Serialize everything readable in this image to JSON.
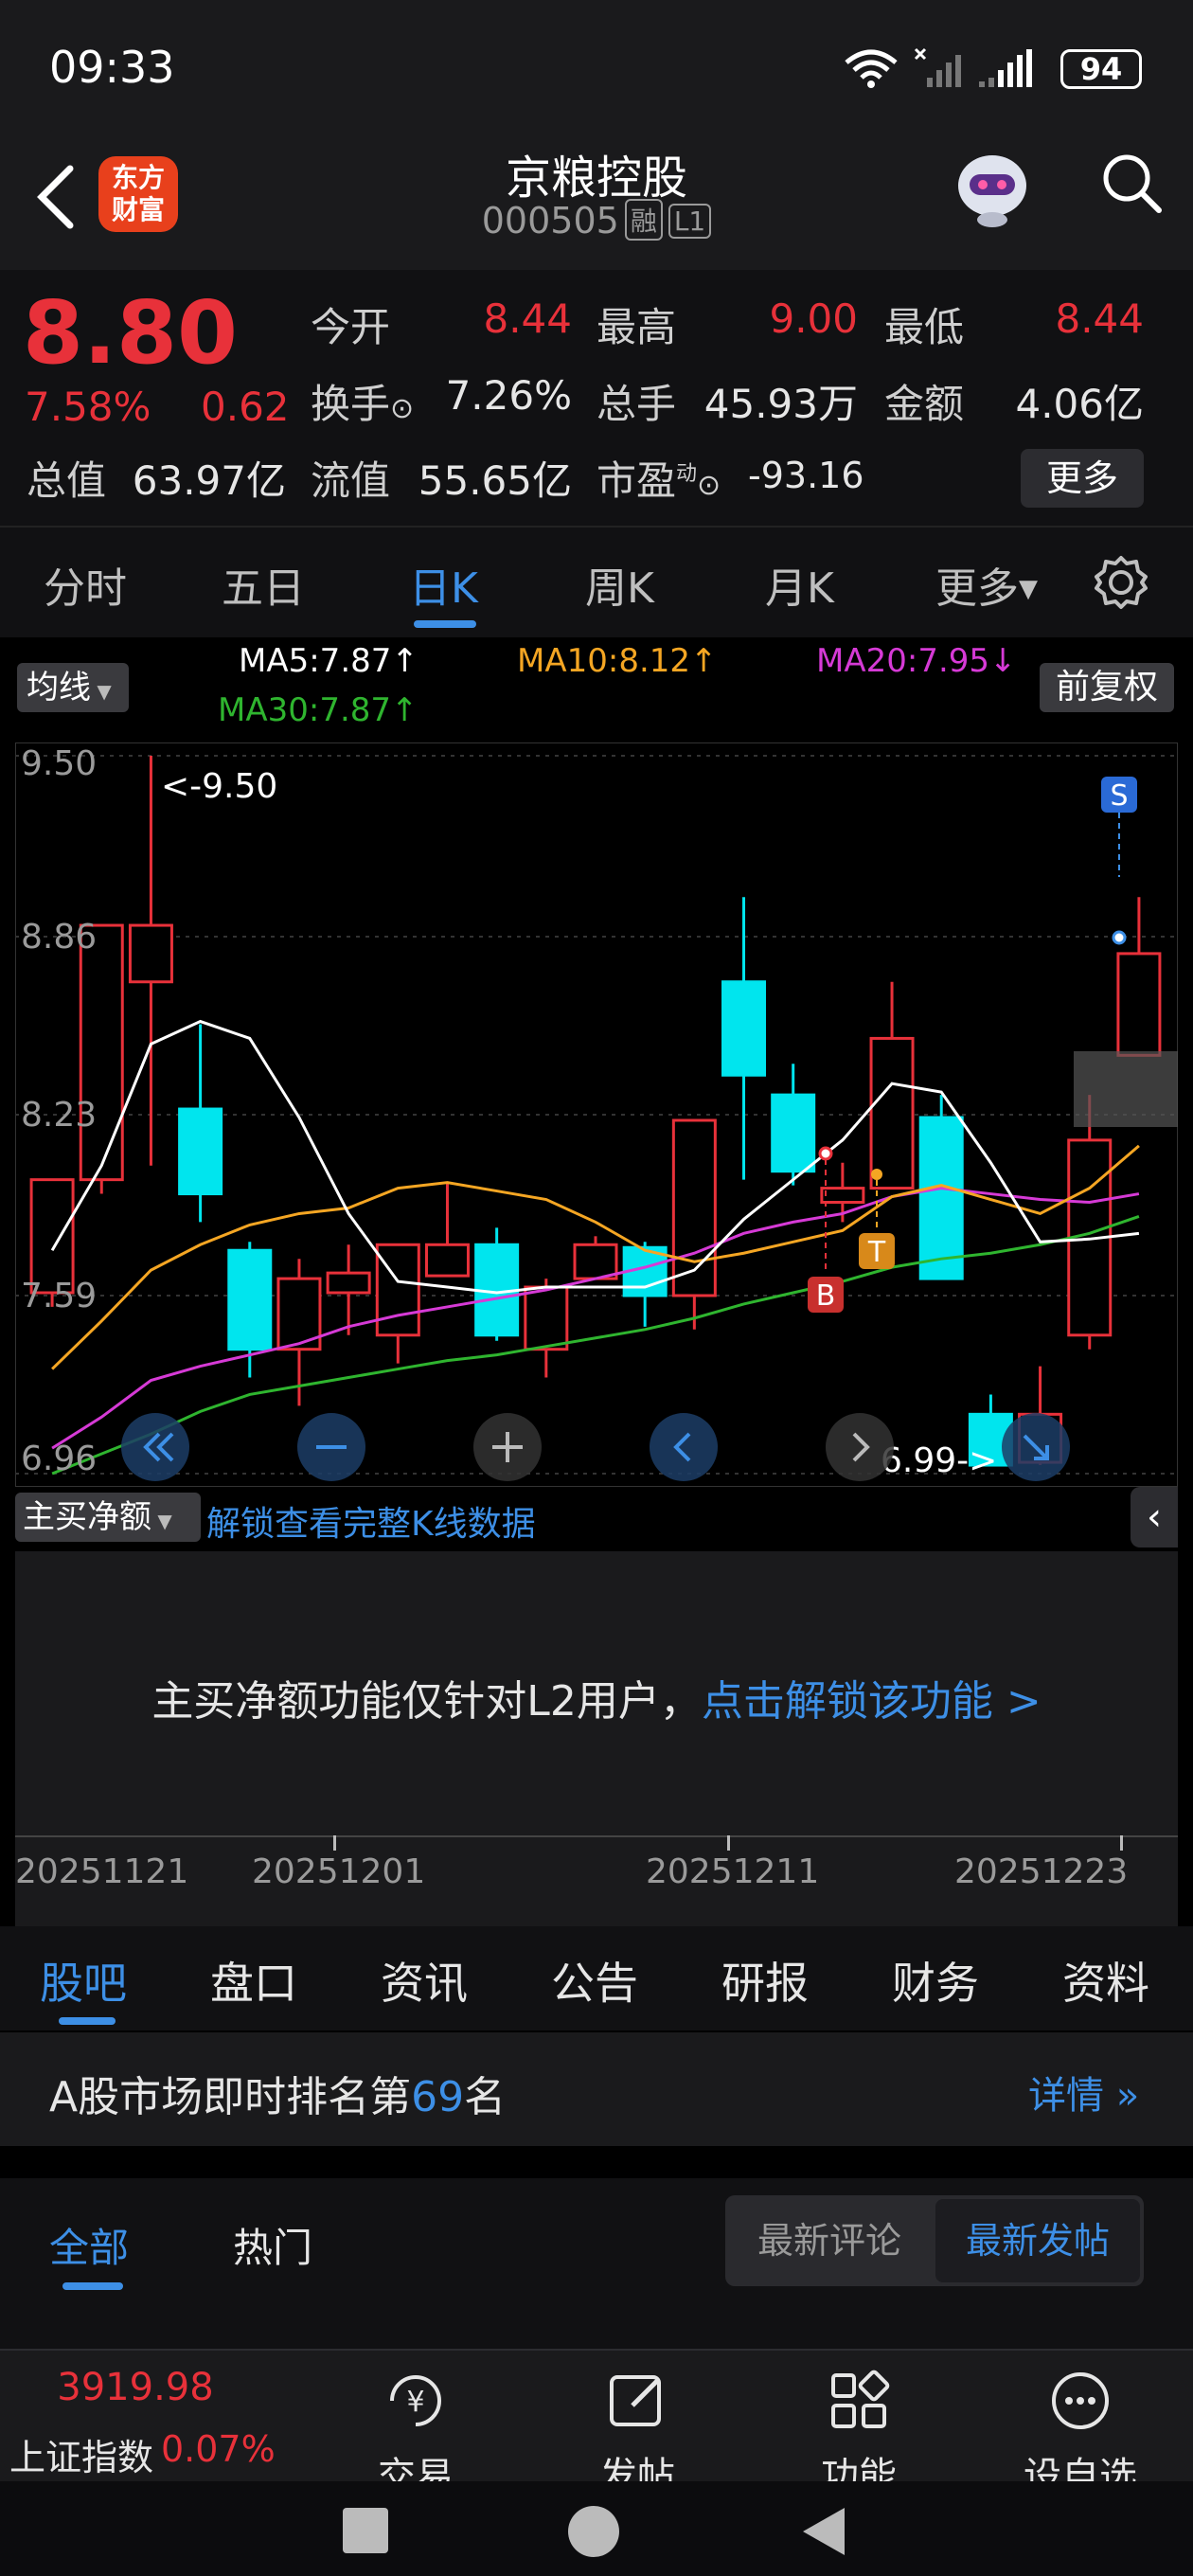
{
  "status_bar": {
    "time": "09:33",
    "battery": "94"
  },
  "header": {
    "title": "京粮控股",
    "code": "000505",
    "tag_margin": "融",
    "tag_level": "L1",
    "logo_line1": "东方",
    "logo_line2": "财富"
  },
  "quote": {
    "price": "8.80",
    "change_pct": "7.58%",
    "change": "0.62",
    "open_label": "今开",
    "open": "8.44",
    "high_label": "最高",
    "high": "9.00",
    "low_label": "最低",
    "low": "8.44",
    "turnover_label": "换手",
    "turnover": "7.26%",
    "volume_label": "总手",
    "volume": "45.93万",
    "amount_label": "金额",
    "amount": "4.06亿",
    "mktcap_label": "总值",
    "mktcap": "63.97亿",
    "float_label": "流值",
    "float": "55.65亿",
    "pe_label": "市盈",
    "pe_sup": "动",
    "pe": "-93.16",
    "more": "更多"
  },
  "chart_tabs": [
    "分时",
    "五日",
    "日K",
    "周K",
    "月K",
    "更多"
  ],
  "ma_row": {
    "junxian": "均线",
    "ma5": "MA5:7.87↑",
    "ma10": "MA10:8.12↑",
    "ma20": "MA20:7.95↓",
    "ma30": "MA30:7.87↑",
    "fuquan": "前复权",
    "colors": {
      "ma5": "#ffffff",
      "ma10": "#f5a623",
      "ma20": "#d63ad6",
      "ma30": "#2fb52f"
    }
  },
  "chart_data": {
    "type": "candlestick",
    "y_ticks": [
      "9.50",
      "8.86",
      "8.23",
      "7.59",
      "6.96"
    ],
    "ylim": [
      6.96,
      9.5
    ],
    "high_annotation": "<-9.50",
    "low_annotation": "6.99->",
    "markers": [
      "S",
      "B",
      "T"
    ],
    "candles": [
      {
        "o": 7.6,
        "c": 8.0,
        "h": 8.0,
        "l": 7.55
      },
      {
        "o": 8.0,
        "c": 8.9,
        "h": 8.9,
        "l": 7.95
      },
      {
        "o": 8.7,
        "c": 8.9,
        "h": 9.5,
        "l": 8.05
      },
      {
        "o": 8.25,
        "c": 7.95,
        "h": 8.55,
        "l": 7.85
      },
      {
        "o": 7.75,
        "c": 7.4,
        "h": 7.78,
        "l": 7.3
      },
      {
        "o": 7.4,
        "c": 7.65,
        "h": 7.72,
        "l": 7.2
      },
      {
        "o": 7.6,
        "c": 7.67,
        "h": 7.77,
        "l": 7.45
      },
      {
        "o": 7.45,
        "c": 7.77,
        "h": 7.77,
        "l": 7.35
      },
      {
        "o": 7.66,
        "c": 7.77,
        "h": 7.99,
        "l": 7.66
      },
      {
        "o": 7.77,
        "c": 7.45,
        "h": 7.83,
        "l": 7.43
      },
      {
        "o": 7.4,
        "c": 7.62,
        "h": 7.65,
        "l": 7.3
      },
      {
        "o": 7.65,
        "c": 7.77,
        "h": 7.8,
        "l": 7.65
      },
      {
        "o": 7.76,
        "c": 7.59,
        "h": 7.78,
        "l": 7.48
      },
      {
        "o": 7.59,
        "c": 8.21,
        "h": 8.21,
        "l": 7.47
      },
      {
        "o": 8.7,
        "c": 8.37,
        "h": 9.0,
        "l": 8.0
      },
      {
        "o": 8.3,
        "c": 8.03,
        "h": 8.41,
        "l": 7.98
      },
      {
        "o": 7.92,
        "c": 7.97,
        "h": 8.06,
        "l": 7.85
      },
      {
        "o": 7.97,
        "c": 8.5,
        "h": 8.7,
        "l": 7.97
      },
      {
        "o": 8.22,
        "c": 7.65,
        "h": 8.3,
        "l": 7.65
      },
      {
        "o": 7.17,
        "c": 6.99,
        "h": 7.24,
        "l": 6.99
      },
      {
        "o": 7.0,
        "c": 7.17,
        "h": 7.34,
        "l": 6.99
      },
      {
        "o": 7.45,
        "c": 8.14,
        "h": 8.3,
        "l": 7.4
      },
      {
        "o": 8.44,
        "c": 8.8,
        "h": 9.0,
        "l": 8.44
      }
    ],
    "ma5": [
      7.75,
      8.05,
      8.48,
      8.56,
      8.5,
      8.22,
      7.88,
      7.64,
      7.62,
      7.6,
      7.62,
      7.62,
      7.62,
      7.68,
      7.86,
      8.0,
      8.14,
      8.34,
      8.31,
      8.06,
      7.78,
      7.79,
      7.81
    ],
    "ma10": [
      7.33,
      7.5,
      7.68,
      7.77,
      7.84,
      7.88,
      7.9,
      7.97,
      7.99,
      7.96,
      7.93,
      7.85,
      7.75,
      7.71,
      7.74,
      7.78,
      7.82,
      7.94,
      7.98,
      7.93,
      7.88,
      7.97,
      8.12
    ],
    "ma20": [
      7.05,
      7.16,
      7.29,
      7.34,
      7.38,
      7.42,
      7.48,
      7.52,
      7.55,
      7.58,
      7.61,
      7.65,
      7.69,
      7.74,
      7.81,
      7.85,
      7.88,
      7.94,
      7.97,
      7.95,
      7.93,
      7.92,
      7.95
    ],
    "ma30": [
      6.96,
      7.03,
      7.1,
      7.18,
      7.24,
      7.27,
      7.3,
      7.33,
      7.36,
      7.38,
      7.41,
      7.44,
      7.47,
      7.51,
      7.56,
      7.6,
      7.64,
      7.69,
      7.72,
      7.74,
      7.77,
      7.81,
      7.87
    ]
  },
  "indicator": {
    "name": "主买净额",
    "unlock": "解锁查看完整K线数据",
    "message": "主买净额功能仅针对L2用户，",
    "message_link": "点击解锁该功能 >"
  },
  "dates": [
    "20251121",
    "20251201",
    "20251211",
    "20251223"
  ],
  "bottom_tabs": [
    "股吧",
    "盘口",
    "资讯",
    "公告",
    "研报",
    "财务",
    "资料"
  ],
  "rank": {
    "prefix": "A股市场即时排名第",
    "rank": "69",
    "suffix": "名",
    "detail": "详情"
  },
  "feed": {
    "all": "全部",
    "hot": "热门",
    "latest_comment": "最新评论",
    "latest_post": "最新发帖"
  },
  "bottom_nav": {
    "index_value": "3919.98",
    "index_name": "上证指数",
    "index_pct": "0.07%",
    "items": [
      "交易",
      "发帖",
      "功能",
      "设自选"
    ]
  },
  "colors": {
    "up": "#e8313a",
    "down": "#00e5ee",
    "accent": "#3d8fe6"
  }
}
